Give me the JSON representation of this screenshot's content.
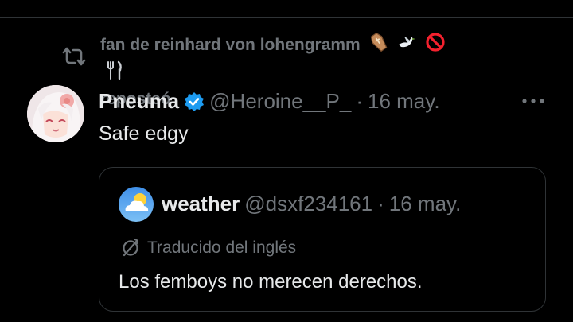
{
  "repost": {
    "line1": "fan de reinhard von lohengramm",
    "line2": "reposteó",
    "emojis": [
      "coffin-emoji",
      "dove-emoji",
      "prohibited-emoji",
      "fork-knife-emoji"
    ]
  },
  "tweet": {
    "display_name": "Pneuma",
    "handle": "@Heroine__P_",
    "separator": "·",
    "date": "16 may.",
    "text": "Safe edgy",
    "verified_color": "#1d9bf0"
  },
  "quote": {
    "display_name": "weather",
    "handle": "@dsxf234161",
    "separator": "·",
    "date": "16 may.",
    "translation_label": "Traducido del inglés",
    "text": "Los femboys no merecen derechos."
  },
  "colors": {
    "background": "#000000",
    "text_primary": "#e7e9ea",
    "text_secondary": "#71767b",
    "border": "#2f3336",
    "accent": "#1d9bf0"
  }
}
